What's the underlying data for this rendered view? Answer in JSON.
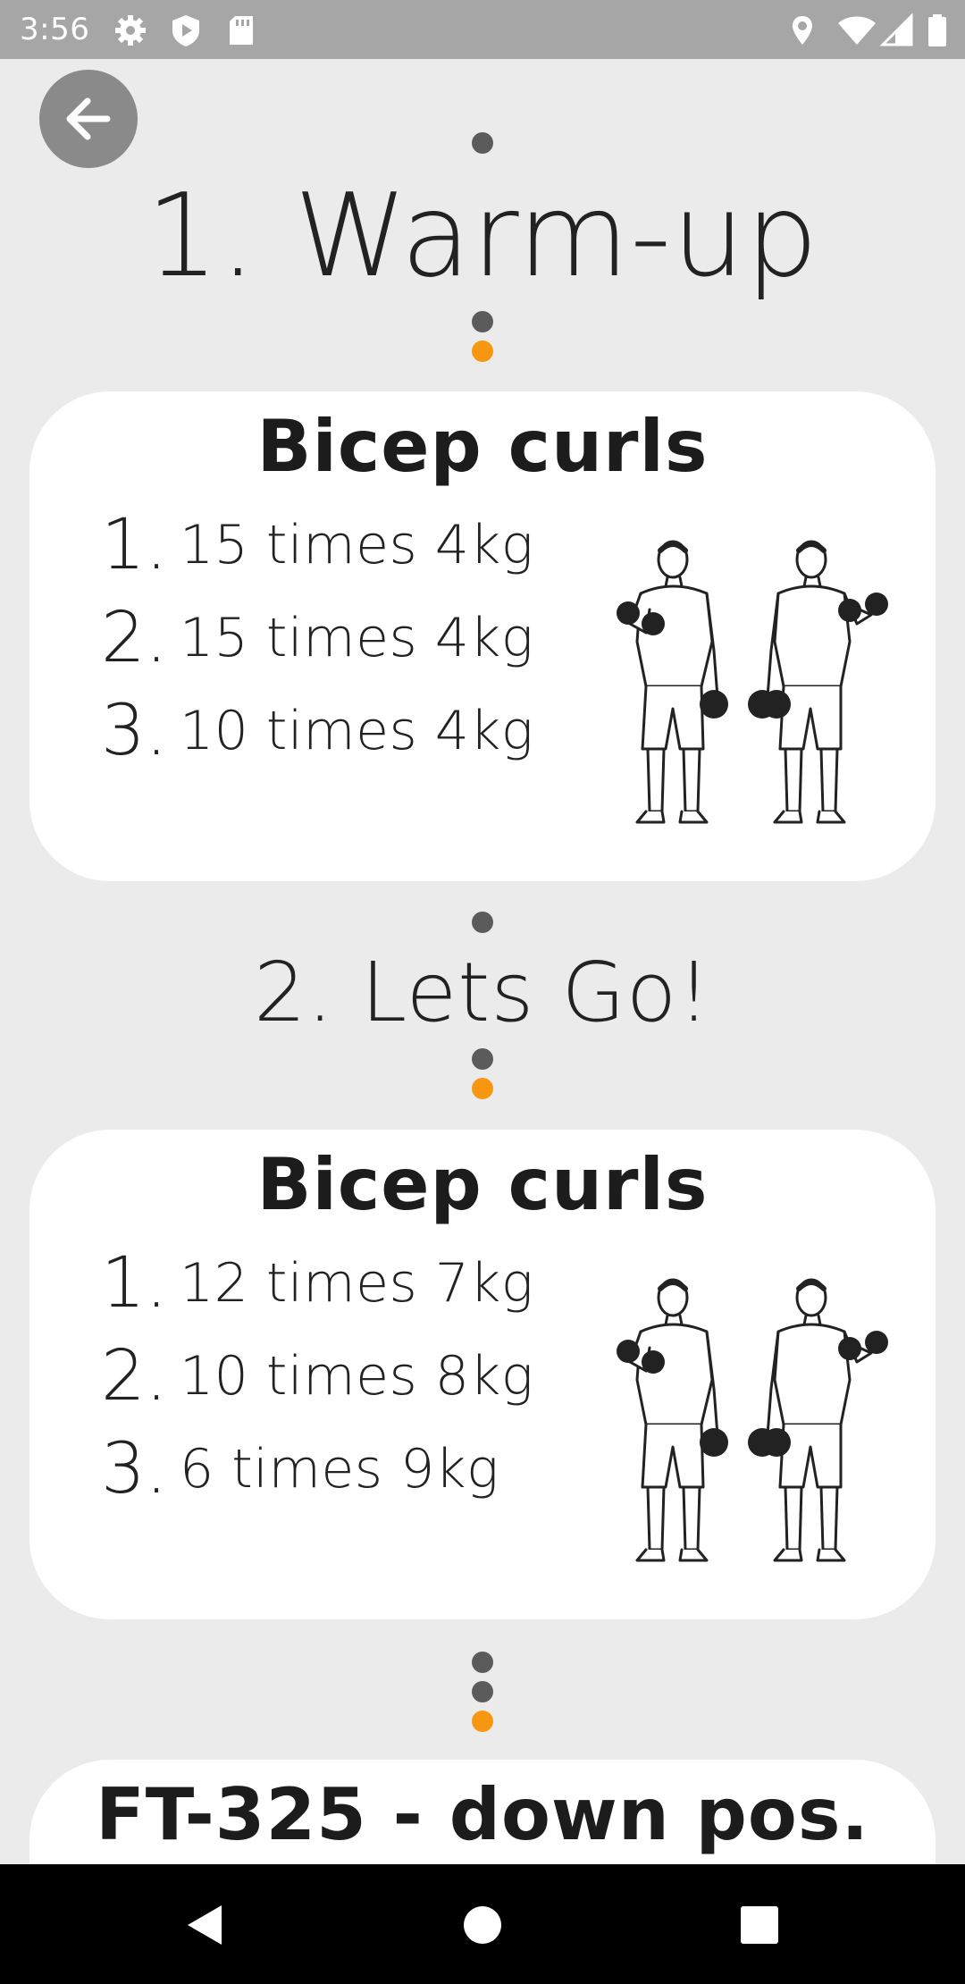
{
  "status_bar": {
    "time": "3:56",
    "icons_left": [
      "gear-icon",
      "shield-play-icon",
      "sd-card-icon"
    ],
    "icons_right": [
      "location-icon",
      "wifi-icon",
      "signal-icon",
      "battery-icon"
    ]
  },
  "header": {
    "back_icon": "arrow-left-icon"
  },
  "sections": [
    {
      "title": "1. Warm-up",
      "card": {
        "exercise_name": "Bicep curls",
        "sets": [
          {
            "num": "1.",
            "text": "15 times 4kg"
          },
          {
            "num": "2.",
            "text": "15 times 4kg"
          },
          {
            "num": "3.",
            "text": "10 times 4kg"
          }
        ],
        "image": "bicep-curl-illustration"
      }
    },
    {
      "title": "2. Lets Go!",
      "card": {
        "exercise_name": "Bicep curls",
        "sets": [
          {
            "num": "1.",
            "text": "12 times 7kg"
          },
          {
            "num": "2.",
            "text": "10 times 8kg"
          },
          {
            "num": "3.",
            "text": "6 times 9kg"
          }
        ],
        "image": "bicep-curl-illustration"
      }
    },
    {
      "card": {
        "exercise_name": "FT-325 - down pos."
      }
    }
  ],
  "colors": {
    "background": "#ebebeb",
    "status_bar": "#a6a6a6",
    "dot_grey": "#5b5b5b",
    "dot_accent": "#f79711",
    "card": "#ffffff"
  },
  "nav_bar": {
    "buttons": [
      "back-triangle-icon",
      "home-circle-icon",
      "recents-square-icon"
    ]
  }
}
